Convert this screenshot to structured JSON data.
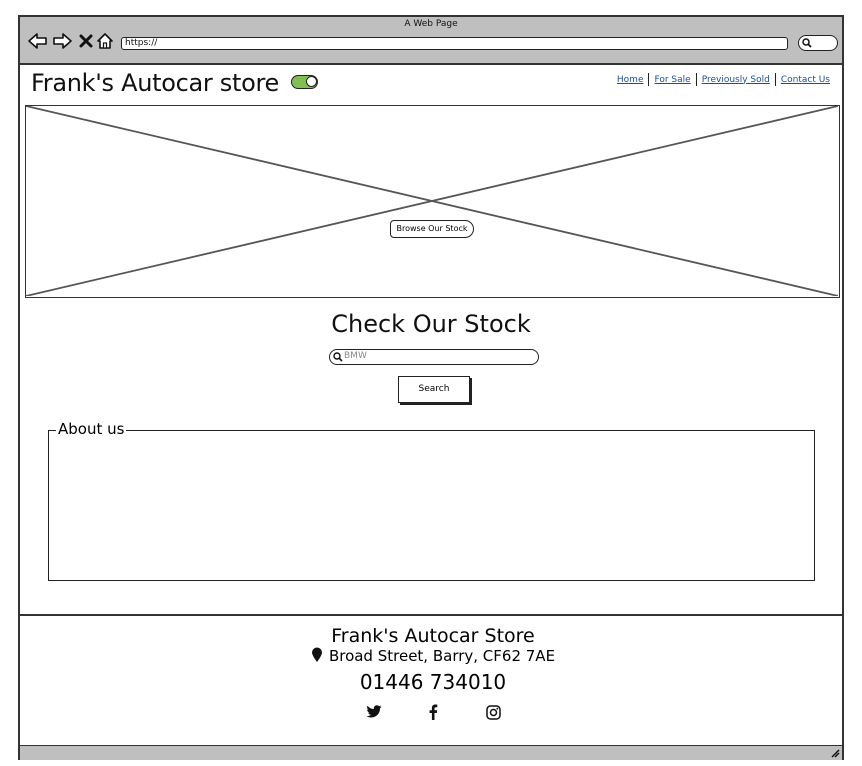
{
  "browser": {
    "window_title": "A Web Page",
    "url": "https://",
    "back_icon": "arrow-left-icon",
    "forward_icon": "arrow-right-icon",
    "stop_icon": "close-icon",
    "home_icon": "home-icon"
  },
  "header": {
    "site_title": "Frank's Autocar store",
    "toggle_on": true,
    "toggle_color": "#7fbf53",
    "nav": [
      {
        "label": "Home"
      },
      {
        "label": "For Sale"
      },
      {
        "label": "Previously Sold"
      },
      {
        "label": "Contact Us"
      }
    ]
  },
  "hero": {
    "button_label": "Browse Our Stock"
  },
  "stock": {
    "title": "Check Our Stock",
    "search_placeholder": "BMW",
    "search_button": "Search"
  },
  "about": {
    "legend": "About us"
  },
  "footer": {
    "name": "Frank's Autocar Store",
    "address": "Broad Street, Barry, CF62 7AE",
    "phone": "01446 734010",
    "social_icons": [
      "twitter-icon",
      "facebook-icon",
      "instagram-icon"
    ]
  }
}
